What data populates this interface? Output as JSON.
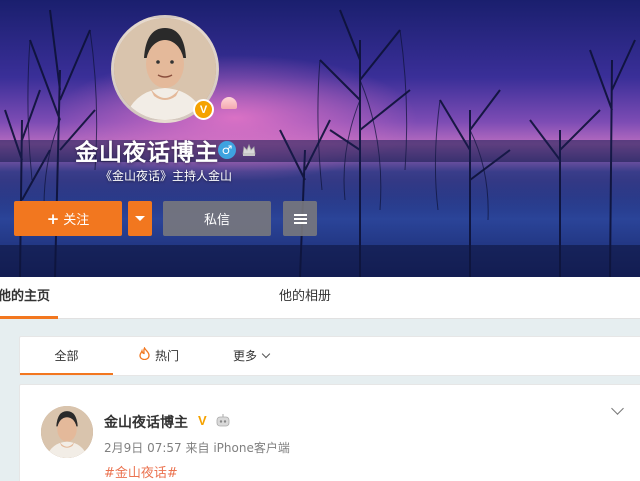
{
  "profile": {
    "name": "金山夜话博主",
    "description": "《金山夜话》主持人金山",
    "verified_badge": "V",
    "gender_icon": "male-icon",
    "level_icon": "crown-icon"
  },
  "actions": {
    "follow_label": "关注",
    "follow_icon": "+",
    "message_label": "私信",
    "menu_icon": "hamburger-icon",
    "dropdown_icon": "triangle-down-icon"
  },
  "tabs": [
    {
      "label": "他的主页",
      "active": true
    },
    {
      "label": "他的相册",
      "active": false
    }
  ],
  "feed_filter": {
    "all_label": "全部",
    "hot_label": "热门",
    "more_label": "更多"
  },
  "post": {
    "author": "金山夜话博主",
    "verified_badge": "V",
    "date": "2月9日 07:57",
    "source_prefix": "来自",
    "source": "iPhone客户端",
    "tag": "#金山夜话#"
  },
  "colors": {
    "accent": "#f2771f",
    "verified": "#f5a200",
    "tag": "#eb7350",
    "gender_male": "#3ea3e0"
  }
}
